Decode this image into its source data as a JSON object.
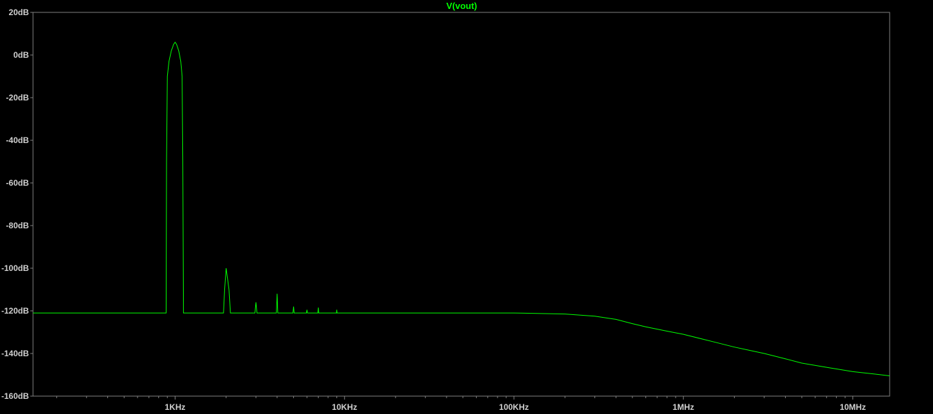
{
  "chart_data": {
    "type": "line",
    "title": "V(vout)",
    "xscale": "log",
    "xlim": [
      145,
      16500000
    ],
    "ylim": [
      -160,
      20
    ],
    "grid": false,
    "background": "#000000",
    "axis_color": "#808080",
    "trace_color": "#00ff00",
    "yticks": [
      20,
      0,
      -20,
      -40,
      -60,
      -80,
      -100,
      -120,
      -140,
      -160
    ],
    "ytick_labels": [
      "20dB",
      "0dB",
      "-20dB",
      "-40dB",
      "-60dB",
      "-80dB",
      "-100dB",
      "-120dB",
      "-140dB",
      "-160dB"
    ],
    "xticks": [
      1000,
      10000,
      100000,
      1000000,
      10000000
    ],
    "xtick_labels": [
      "1KHz",
      "10KHz",
      "100KHz",
      "1MHz",
      "10MHz"
    ],
    "series": [
      {
        "name": "V(vout)",
        "x": [
          145,
          880,
          885,
          890,
          900,
          920,
          950,
          980,
          1000,
          1020,
          1050,
          1080,
          1100,
          1110,
          1120,
          1900,
          1930,
          1960,
          2000,
          2040,
          2080,
          2120,
          2150,
          2900,
          2960,
          3000,
          3040,
          3100,
          3900,
          3960,
          4000,
          4040,
          4100,
          4900,
          4960,
          5000,
          5040,
          5100,
          5900,
          5960,
          6000,
          6040,
          6100,
          6900,
          6960,
          7000,
          7040,
          7100,
          8900,
          8960,
          9000,
          9040,
          9100,
          100000,
          200000,
          300000,
          400000,
          500000,
          600000,
          800000,
          1000000,
          1500000,
          2000000,
          3000000,
          4000000,
          5000000,
          7000000,
          10000000,
          13000000,
          16500000
        ],
        "y": [
          -121,
          -121,
          -121,
          -50,
          -10,
          -3,
          2,
          5,
          6,
          5,
          2,
          -3,
          -10,
          -50,
          -121,
          -121,
          -121,
          -110,
          -100,
          -105,
          -110,
          -121,
          -121,
          -121,
          -121,
          -116,
          -121,
          -121,
          -121,
          -121,
          -112,
          -121,
          -121,
          -121,
          -121,
          -118,
          -121,
          -121,
          -121,
          -121,
          -119.5,
          -121,
          -121,
          -121,
          -121,
          -118.5,
          -121,
          -121,
          -121,
          -121,
          -119.5,
          -121,
          -121,
          -121,
          -121.5,
          -122.5,
          -124,
          -126,
          -127.5,
          -129.5,
          -131,
          -134.5,
          -137,
          -140,
          -142.5,
          -144.5,
          -146.5,
          -148.5,
          -149.5,
          -150.5
        ]
      }
    ]
  }
}
